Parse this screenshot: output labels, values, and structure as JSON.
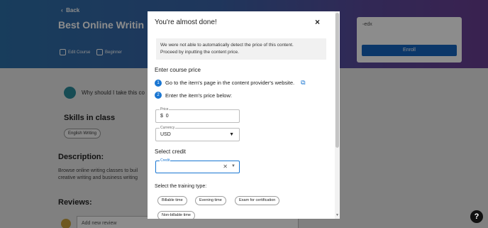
{
  "background": {
    "back_label": "Back",
    "course_title": "Best Online Writin",
    "meta_edit": "Edit Course",
    "meta_level": "Beginner",
    "edx_image_alt": "edx",
    "enroll_label": "Enroll",
    "why_text": "Why should I take this co",
    "skills_heading": "Skills in class",
    "skill_chip": "English Writing",
    "description_heading": "Description:",
    "description_lines": [
      "Browse online writing classes to buil",
      "creative writing and business writing"
    ],
    "reviews_heading": "Reviews:",
    "review_placeholder": "Add new review",
    "help_icon": "?"
  },
  "modal": {
    "title": "You're almost done!",
    "close_icon": "×",
    "notice_line1": "We were not able to automatically detect the price of this content.",
    "notice_line2": "Proceed by inputting the content price.",
    "enter_price_heading": "Enter course price",
    "steps": [
      {
        "num": "1",
        "text": "Go to the item's page in the content provider's website."
      },
      {
        "num": "2",
        "text": "Enter the item's price below:"
      }
    ],
    "price_field": {
      "label": "Price",
      "prefix": "$",
      "value": "0"
    },
    "currency_field": {
      "label": "Currency",
      "value": "USD"
    },
    "select_credit_heading": "Select credit",
    "credit_field": {
      "label": "Credit",
      "value": ""
    },
    "training_type_heading": "Select the training type:",
    "training_types": [
      "Billable time",
      "Evening time",
      "Exam for certification",
      "Non-billable time"
    ]
  }
}
